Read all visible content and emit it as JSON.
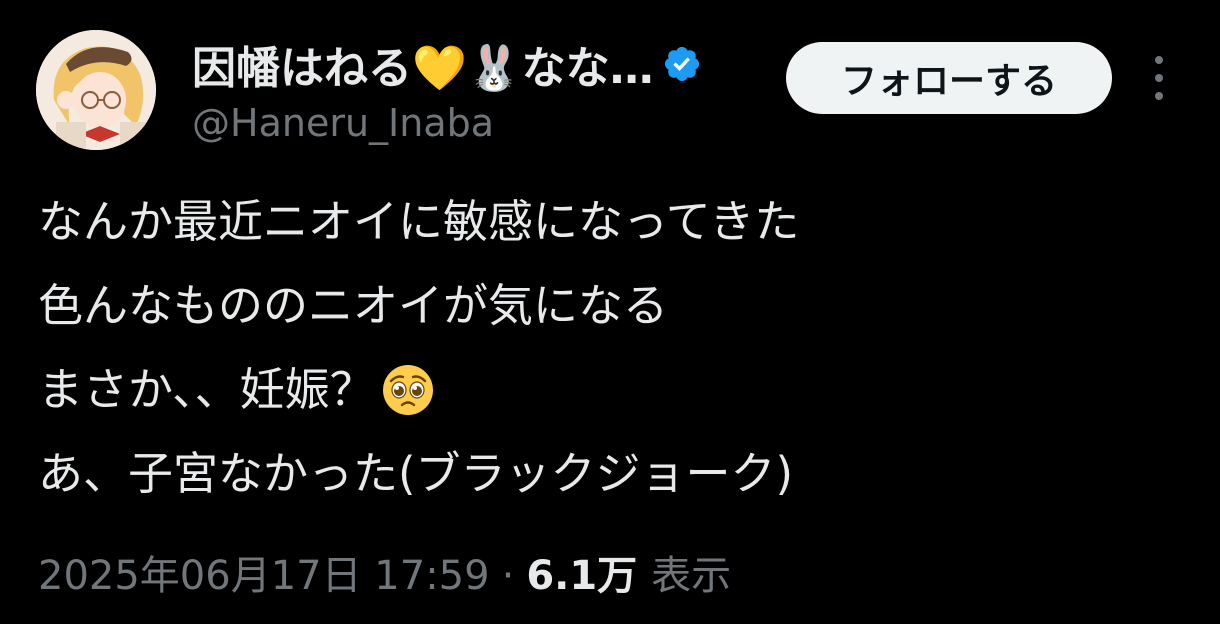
{
  "user": {
    "display_name": "因幡はねる💛🐰なな…",
    "handle": "@Haneru_Inaba",
    "verified": true,
    "verified_color": "#1d9bf0"
  },
  "actions": {
    "follow_label": "フォローする",
    "more_icon": "more-vertical-icon"
  },
  "tweet": {
    "lines": [
      "なんか最近ニオイに敏感になってきた",
      "色んなもののニオイが気になる",
      "まさか、、妊娠？",
      "あ、子宮なかった(ブラックジョーク)"
    ],
    "line3_emoji": "pleading-face-emoji"
  },
  "meta": {
    "timestamp": "2025年06月17日 17:59",
    "separator": "·",
    "views_count": "6.1万",
    "views_label": "表示"
  },
  "colors": {
    "background": "#000000",
    "primary_text": "#e7e9ea",
    "secondary_text": "#71767b",
    "follow_button_bg": "#eff3f4"
  }
}
